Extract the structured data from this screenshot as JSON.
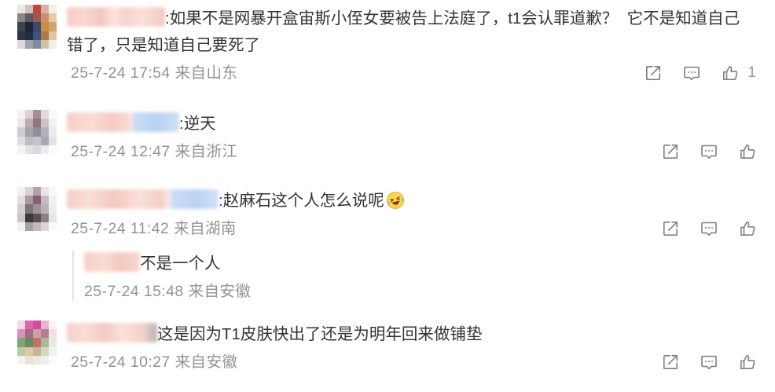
{
  "comments": [
    {
      "text": ":如果不是网暴开盒宙斯小侄女要被告上法庭了，t1会认罪道歉？  它不是知道自己错了，只是知道自己要死了",
      "timestamp": "25-7-24 17:54",
      "source": "来自山东",
      "like_count": "1"
    },
    {
      "text": ":逆天",
      "timestamp": "25-7-24 12:47",
      "source": "来自浙江"
    },
    {
      "text": ":赵麻石这个人怎么说呢",
      "emoji": "laugh-cry-emoji-icon",
      "timestamp": "25-7-24 11:42",
      "source": "来自湖南",
      "replies": [
        {
          "text": "不是一个人",
          "timestamp": "25-7-24 15:48",
          "source": "来自安徽"
        }
      ]
    },
    {
      "text": "这是因为T1皮肤快出了还是为明年回来做铺垫",
      "timestamp": "25-7-24 10:27",
      "source": "来自安徽"
    }
  ],
  "icons": {
    "share": "share-icon",
    "comment": "comment-icon",
    "like": "like-icon"
  },
  "colors": {
    "text": "#333333",
    "meta": "#939393",
    "icon": "#7f7f7f",
    "reply_border": "#e4e4e4"
  }
}
